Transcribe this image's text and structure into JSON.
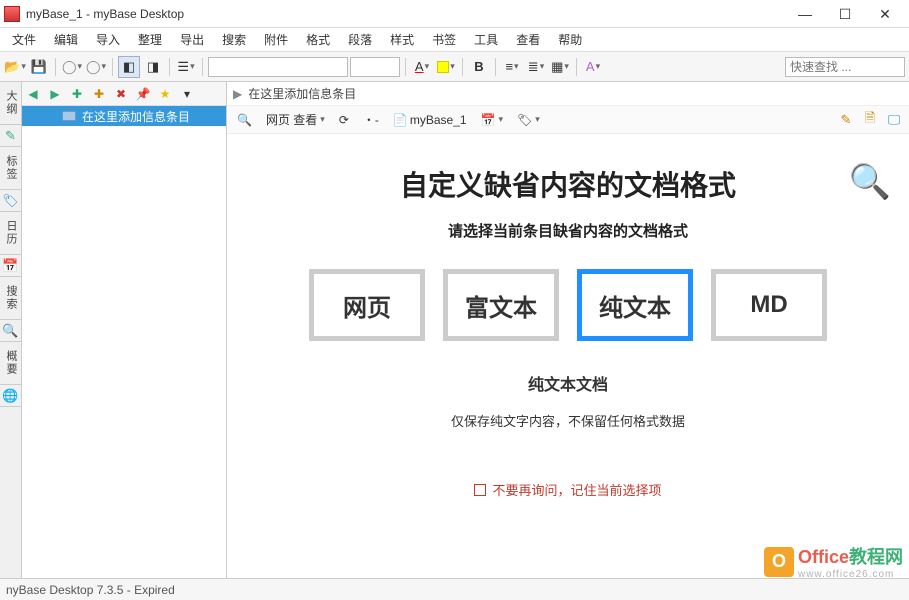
{
  "window": {
    "title": "myBase_1 - myBase Desktop",
    "min": "—",
    "max": "☐",
    "close": "✕"
  },
  "menu": [
    "文件",
    "编辑",
    "导入",
    "整理",
    "导出",
    "搜索",
    "附件",
    "格式",
    "段落",
    "样式",
    "书签",
    "工具",
    "查看",
    "帮助"
  ],
  "toolbar": {
    "folder": "📂",
    "save": "💾",
    "history_dd": "▾",
    "workspace": "▭",
    "panel_a": "◧",
    "panel_b": "◨",
    "layout": "☰",
    "font_family_ph": "",
    "font_size_ph": "",
    "font_color": "A",
    "bold": "B",
    "align": "≡",
    "list": "≣",
    "table": "▦",
    "search_ph": "快速查找 ..."
  },
  "tree_tb": {
    "left": "◀",
    "right": "▶",
    "add": "✚",
    "addchild": "✚",
    "del": "✖",
    "pin": "📌",
    "star": "★",
    "more": "▾"
  },
  "tree": {
    "item0": "在这里添加信息条目"
  },
  "vtabs": [
    "大纲",
    "标签",
    "日历",
    "搜索",
    "概要"
  ],
  "crumb": {
    "arrow": "▶",
    "text": "在这里添加信息条目"
  },
  "subtb": {
    "search": "🔍",
    "webview": "网页 查看",
    "dd": "▾",
    "refresh": "⟳",
    "nav": "・-",
    "doc_icon": "📄",
    "doc_name": "myBase_1",
    "cal": "📅",
    "tag": "🏷",
    "r_edit": "✎",
    "r_new": "🗎",
    "r_view": "🖵"
  },
  "doc": {
    "title": "自定义缺省内容的文档格式",
    "subtitle": "请选择当前条目缺省内容的文档格式",
    "formats": [
      "网页",
      "富文本",
      "纯文本",
      "MD"
    ],
    "selected_index": 2,
    "selected_title": "纯文本文档",
    "selected_desc": "仅保存纯文字内容，不保留任何格式数据",
    "checkbox_label": "不要再询问，记住当前选择项"
  },
  "status": {
    "text": "nyBase Desktop 7.3.5 - Expired"
  },
  "magnifier": "🔍",
  "watermark": {
    "brand_a": "Office",
    "brand_b": "教程网",
    "sub": "www.office26.com"
  }
}
